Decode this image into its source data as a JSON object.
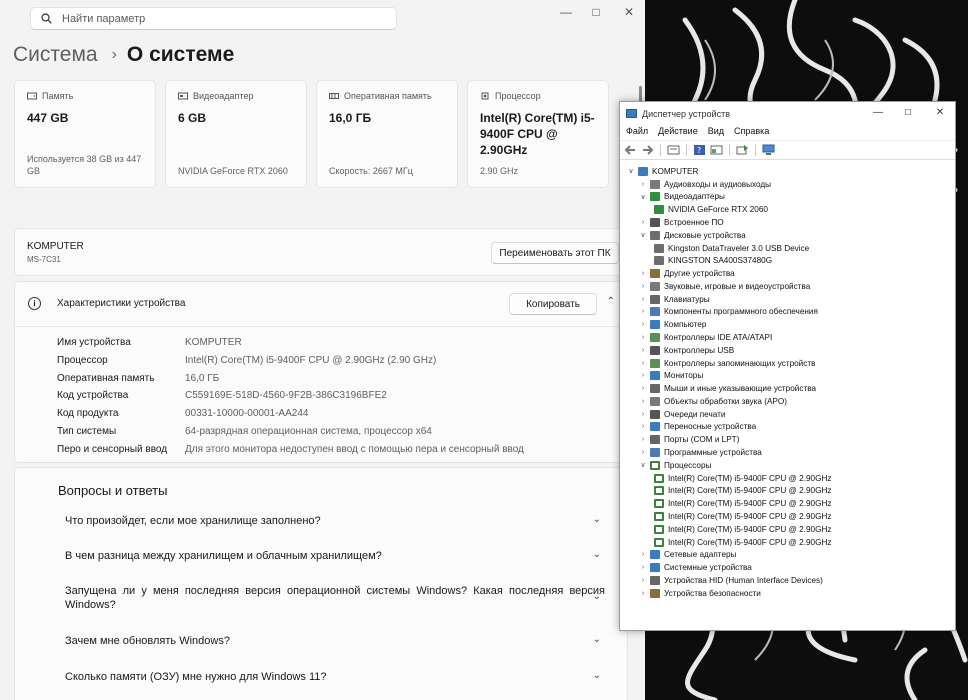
{
  "search": {
    "placeholder": "Найти параметр"
  },
  "breadcrumb": {
    "parent": "Система",
    "current": "О системе"
  },
  "cards": [
    {
      "label": "Память",
      "value": "447 GB",
      "sub": "Используется 38 GB из 447 GB"
    },
    {
      "label": "Видеоадаптер",
      "value": "6 GB",
      "sub": "NVIDIA GeForce RTX 2060"
    },
    {
      "label": "Оперативная память",
      "value": "16,0 ГБ",
      "sub": "Скорость: 2667 МГц"
    },
    {
      "label": "Процессор",
      "value": "Intel(R) Core(TM) i5-9400F CPU @ 2.90GHz",
      "sub": "2.90 GHz"
    }
  ],
  "pc": {
    "name": "KOMPUTER",
    "model": "MS-7C31",
    "rename_label": "Переименовать этот ПК"
  },
  "specs": {
    "title": "Характеристики устройства",
    "copy_label": "Копировать",
    "rows": [
      {
        "k": "Имя устройства",
        "v": "KOMPUTER"
      },
      {
        "k": "Процессор",
        "v": "Intel(R) Core(TM) i5-9400F CPU @ 2.90GHz (2.90 GHz)"
      },
      {
        "k": "Оперативная память",
        "v": "16,0 ГБ"
      },
      {
        "k": "Код устройства",
        "v": "C559169E-518D-4560-9F2B-386C3196BFE2"
      },
      {
        "k": "Код продукта",
        "v": "00331-10000-00001-AA244"
      },
      {
        "k": "Тип системы",
        "v": "64-разрядная операционная система, процессор x64"
      },
      {
        "k": "Перо и сенсорный ввод",
        "v": "Для этого монитора недоступен ввод с помощью пера и сенсорный ввод"
      }
    ]
  },
  "faq": {
    "title": "Вопросы и ответы",
    "items": [
      "Что произойдет, если мое хранилище заполнено?",
      "В чем разница между хранилищем и облачным хранилищем?",
      "Запущена ли у меня последняя версия операционной системы Windows? Какая последняя версия Windows?",
      "Зачем мне обновлять Windows?",
      "Сколько памяти (ОЗУ) мне нужно для Windows 11?"
    ]
  },
  "devmgr": {
    "title": "Диспетчер устройств",
    "menu": [
      "Файл",
      "Действие",
      "Вид",
      "Справка"
    ],
    "tree": [
      {
        "label": "KOMPUTER",
        "level": 0,
        "exp": "open",
        "icon": "computer-icon",
        "color": "#3b7bbf"
      },
      {
        "label": "Аудиовходы и аудиовыходы",
        "level": 1,
        "exp": "closed",
        "icon": "audio-icon",
        "color": "#7a7a7a"
      },
      {
        "label": "Видеоадаптеры",
        "level": 1,
        "exp": "open",
        "icon": "display-adapter-icon",
        "color": "#2f8f3f"
      },
      {
        "label": "NVIDIA GeForce RTX 2060",
        "level": 2,
        "exp": "none",
        "icon": "display-adapter-icon",
        "color": "#2f8f3f"
      },
      {
        "label": "Встроенное ПО",
        "level": 1,
        "exp": "closed",
        "icon": "firmware-icon",
        "color": "#555555"
      },
      {
        "label": "Дисковые устройства",
        "level": 1,
        "exp": "open",
        "icon": "disk-icon",
        "color": "#6d6d6d"
      },
      {
        "label": "Kingston DataTraveler 3.0 USB Device",
        "level": 2,
        "exp": "none",
        "icon": "disk-icon",
        "color": "#6d6d6d"
      },
      {
        "label": "KINGSTON SA400S37480G",
        "level": 2,
        "exp": "none",
        "icon": "disk-icon",
        "color": "#6d6d6d"
      },
      {
        "label": "Другие устройства",
        "level": 1,
        "exp": "closed",
        "icon": "other-devices-icon",
        "color": "#8a6d3b"
      },
      {
        "label": "Звуковые, игровые и видеоустройства",
        "level": 1,
        "exp": "closed",
        "icon": "sound-icon",
        "color": "#7a7a7a"
      },
      {
        "label": "Клавиатуры",
        "level": 1,
        "exp": "closed",
        "icon": "keyboard-icon",
        "color": "#666666"
      },
      {
        "label": "Компоненты программного обеспечения",
        "level": 1,
        "exp": "closed",
        "icon": "software-component-icon",
        "color": "#4d7cb5"
      },
      {
        "label": "Компьютер",
        "level": 1,
        "exp": "closed",
        "icon": "computer-icon",
        "color": "#3b7bbf"
      },
      {
        "label": "Контроллеры IDE ATA/ATAPI",
        "level": 1,
        "exp": "closed",
        "icon": "ide-icon",
        "color": "#5a8f5a"
      },
      {
        "label": "Контроллеры USB",
        "level": 1,
        "exp": "closed",
        "icon": "usb-icon",
        "color": "#555555"
      },
      {
        "label": "Контроллеры запоминающих устройств",
        "level": 1,
        "exp": "closed",
        "icon": "storage-controller-icon",
        "color": "#5a8f5a"
      },
      {
        "label": "Мониторы",
        "level": 1,
        "exp": "closed",
        "icon": "monitor-icon",
        "color": "#3b7bbf"
      },
      {
        "label": "Мыши и иные указывающие устройства",
        "level": 1,
        "exp": "closed",
        "icon": "mouse-icon",
        "color": "#666666"
      },
      {
        "label": "Объекты обработки звука (APO)",
        "level": 1,
        "exp": "closed",
        "icon": "apo-icon",
        "color": "#7a7a7a"
      },
      {
        "label": "Очереди печати",
        "level": 1,
        "exp": "closed",
        "icon": "printer-icon",
        "color": "#555555"
      },
      {
        "label": "Переносные устройства",
        "level": 1,
        "exp": "closed",
        "icon": "portable-device-icon",
        "color": "#3b7bbf"
      },
      {
        "label": "Порты (COM и LPT)",
        "level": 1,
        "exp": "closed",
        "icon": "port-icon",
        "color": "#666666"
      },
      {
        "label": "Программные устройства",
        "level": 1,
        "exp": "closed",
        "icon": "software-device-icon",
        "color": "#4d7cb5"
      },
      {
        "label": "Процессоры",
        "level": 1,
        "exp": "open",
        "icon": "cpu-icon",
        "color": "#3f7f3f"
      },
      {
        "label": "Intel(R) Core(TM) i5-9400F CPU @ 2.90GHz",
        "level": 2,
        "exp": "none",
        "icon": "cpu-icon",
        "color": "#3f7f3f"
      },
      {
        "label": "Intel(R) Core(TM) i5-9400F CPU @ 2.90GHz",
        "level": 2,
        "exp": "none",
        "icon": "cpu-icon",
        "color": "#3f7f3f"
      },
      {
        "label": "Intel(R) Core(TM) i5-9400F CPU @ 2.90GHz",
        "level": 2,
        "exp": "none",
        "icon": "cpu-icon",
        "color": "#3f7f3f"
      },
      {
        "label": "Intel(R) Core(TM) i5-9400F CPU @ 2.90GHz",
        "level": 2,
        "exp": "none",
        "icon": "cpu-icon",
        "color": "#3f7f3f"
      },
      {
        "label": "Intel(R) Core(TM) i5-9400F CPU @ 2.90GHz",
        "level": 2,
        "exp": "none",
        "icon": "cpu-icon",
        "color": "#3f7f3f"
      },
      {
        "label": "Intel(R) Core(TM) i5-9400F CPU @ 2.90GHz",
        "level": 2,
        "exp": "none",
        "icon": "cpu-icon",
        "color": "#3f7f3f"
      },
      {
        "label": "Сетевые адаптеры",
        "level": 1,
        "exp": "closed",
        "icon": "network-adapter-icon",
        "color": "#3b7bbf"
      },
      {
        "label": "Системные устройства",
        "level": 1,
        "exp": "closed",
        "icon": "system-device-icon",
        "color": "#3b7bbf"
      },
      {
        "label": "Устройства HID (Human Interface Devices)",
        "level": 1,
        "exp": "closed",
        "icon": "hid-icon",
        "color": "#666666"
      },
      {
        "label": "Устройства безопасности",
        "level": 1,
        "exp": "closed",
        "icon": "security-device-icon",
        "color": "#8a6d3b"
      }
    ]
  }
}
